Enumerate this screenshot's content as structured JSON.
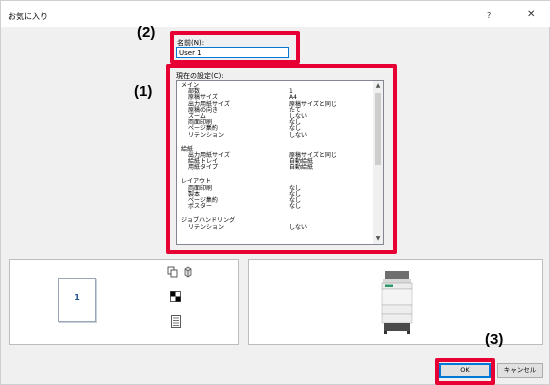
{
  "window": {
    "title": "お気に入り",
    "help_label": "?",
    "close_label": "✕"
  },
  "callouts": {
    "one": "(1)",
    "two": "(2)",
    "three": "(3)"
  },
  "name_field": {
    "label": "名前(N):",
    "value": "User 1"
  },
  "settings": {
    "label": "現在の設定(C):",
    "rows": [
      {
        "key": "メイン",
        "value": "",
        "indent": false
      },
      {
        "key": "部数",
        "value": "1",
        "indent": true
      },
      {
        "key": "原稿サイズ",
        "value": "A4",
        "indent": true
      },
      {
        "key": "出力用紙サイズ",
        "value": "原稿サイズと同じ",
        "indent": true
      },
      {
        "key": "原稿の向き",
        "value": "たて",
        "indent": true
      },
      {
        "key": "ズーム",
        "value": "しない",
        "indent": true
      },
      {
        "key": "両面印刷",
        "value": "なし",
        "indent": true
      },
      {
        "key": "ページ集約",
        "value": "なし",
        "indent": true
      },
      {
        "key": "リテンション",
        "value": "しない",
        "indent": true
      },
      {
        "key": "",
        "value": "",
        "indent": false,
        "gap": true
      },
      {
        "key": "給紙",
        "value": "",
        "indent": false
      },
      {
        "key": "出力用紙サイズ",
        "value": "原稿サイズと同じ",
        "indent": true
      },
      {
        "key": "給紙トレイ",
        "value": "自動給紙",
        "indent": true
      },
      {
        "key": "用紙タイプ",
        "value": "自動給紙",
        "indent": true
      },
      {
        "key": "",
        "value": "",
        "indent": false,
        "gap": true
      },
      {
        "key": "レイアウト",
        "value": "",
        "indent": false
      },
      {
        "key": "両面印刷",
        "value": "なし",
        "indent": true
      },
      {
        "key": "製本",
        "value": "なし",
        "indent": true
      },
      {
        "key": "ページ集約",
        "value": "なし",
        "indent": true
      },
      {
        "key": "ポスター",
        "value": "なし",
        "indent": true
      },
      {
        "key": "",
        "value": "",
        "indent": false,
        "gap": true
      },
      {
        "key": "ジョブハンドリング",
        "value": "",
        "indent": false
      },
      {
        "key": "リテンション",
        "value": "しない",
        "indent": true
      }
    ]
  },
  "preview": {
    "page_number": "1"
  },
  "buttons": {
    "ok": "OK",
    "cancel": "キャンセル"
  }
}
